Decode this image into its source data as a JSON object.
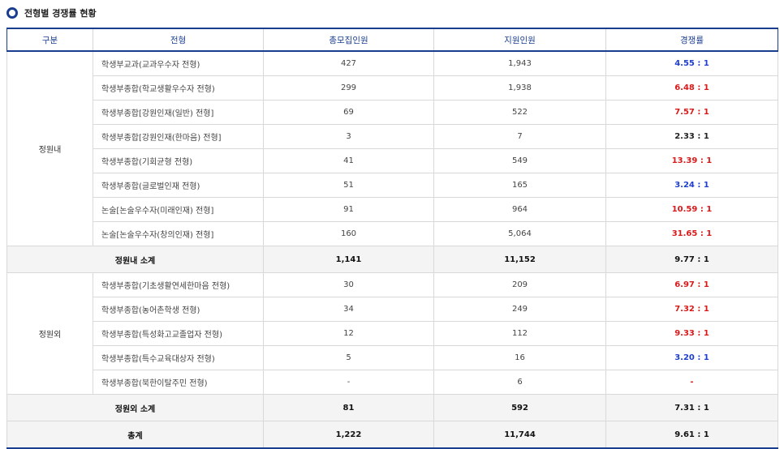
{
  "title": "전형별 경쟁률 현황",
  "colors": {
    "accent": "#1a3e8f",
    "red": "#d91a1a",
    "blue": "#1f3fcf",
    "dark": "#222222"
  },
  "headers": [
    "구분",
    "전형",
    "총모집인원",
    "지원인원",
    "경쟁률"
  ],
  "groups": [
    {
      "label": "정원내",
      "rows": [
        {
          "name": "학생부교과(교과우수자 전형)",
          "quota": "427",
          "applicants": "1,943",
          "rate": "4.55 : 1",
          "rate_color": "blue"
        },
        {
          "name": "학생부종합(학교생활우수자 전형)",
          "quota": "299",
          "applicants": "1,938",
          "rate": "6.48 : 1",
          "rate_color": "red"
        },
        {
          "name": "학생부종합[강원인재(일반) 전형]",
          "quota": "69",
          "applicants": "522",
          "rate": "7.57 : 1",
          "rate_color": "red"
        },
        {
          "name": "학생부종합[강원인재(한마음) 전형]",
          "quota": "3",
          "applicants": "7",
          "rate": "2.33 : 1",
          "rate_color": "dark"
        },
        {
          "name": "학생부종합(기회균형 전형)",
          "quota": "41",
          "applicants": "549",
          "rate": "13.39 : 1",
          "rate_color": "red"
        },
        {
          "name": "학생부종합(글로벌인재 전형)",
          "quota": "51",
          "applicants": "165",
          "rate": "3.24 : 1",
          "rate_color": "blue"
        },
        {
          "name": "논술[논술우수자(미래인재) 전형]",
          "quota": "91",
          "applicants": "964",
          "rate": "10.59 : 1",
          "rate_color": "red"
        },
        {
          "name": "논술[논술우수자(창의인재) 전형]",
          "quota": "160",
          "applicants": "5,064",
          "rate": "31.65 : 1",
          "rate_color": "red"
        }
      ],
      "subtotal": {
        "label": "정원내 소계",
        "quota": "1,141",
        "applicants": "11,152",
        "rate": "9.77 : 1"
      }
    },
    {
      "label": "정원외",
      "rows": [
        {
          "name": "학생부종합(기초생활연세한마음 전형)",
          "quota": "30",
          "applicants": "209",
          "rate": "6.97 : 1",
          "rate_color": "red"
        },
        {
          "name": "학생부종합(농어촌학생 전형)",
          "quota": "34",
          "applicants": "249",
          "rate": "7.32 : 1",
          "rate_color": "red"
        },
        {
          "name": "학생부종합(특성화고교졸업자 전형)",
          "quota": "12",
          "applicants": "112",
          "rate": "9.33 : 1",
          "rate_color": "red"
        },
        {
          "name": "학생부종합(특수교육대상자 전형)",
          "quota": "5",
          "applicants": "16",
          "rate": "3.20 : 1",
          "rate_color": "blue"
        },
        {
          "name": "학생부종합(북한이탈주민 전형)",
          "quota": "-",
          "applicants": "6",
          "rate": "-",
          "rate_color": "red"
        }
      ],
      "subtotal": {
        "label": "정원외 소계",
        "quota": "81",
        "applicants": "592",
        "rate": "7.31 : 1"
      }
    }
  ],
  "total": {
    "label": "총계",
    "quota": "1,222",
    "applicants": "11,744",
    "rate": "9.61 : 1"
  }
}
